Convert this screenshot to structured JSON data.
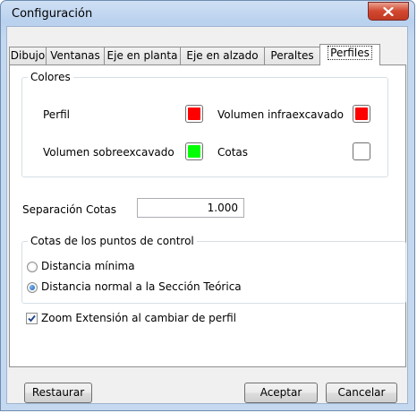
{
  "window": {
    "title": "Configuración",
    "close_glyph": "✕"
  },
  "tabs": [
    {
      "label": "Dibujo"
    },
    {
      "label": "Ventanas"
    },
    {
      "label": "Eje en planta"
    },
    {
      "label": "Eje en alzado"
    },
    {
      "label": "Peraltes"
    },
    {
      "label": "Perfiles",
      "active": true
    }
  ],
  "colores": {
    "legend": "Colores",
    "perfil": {
      "label": "Perfil",
      "color": "#ff0000"
    },
    "volumen_infra": {
      "label": "Volumen infraexcavado",
      "color": "#ff0000"
    },
    "volumen_sobre": {
      "label": "Volumen sobreexcavado",
      "color": "#00ff00"
    },
    "cotas": {
      "label": "Cotas",
      "color": "#ffffff"
    }
  },
  "separacion": {
    "label": "Separación Cotas",
    "value": "1.000"
  },
  "puntos_control": {
    "legend": "Cotas de los puntos de control",
    "options": [
      {
        "label": "Distancia mínima",
        "selected": false
      },
      {
        "label": "Distancia normal a la Sección Teórica",
        "selected": true
      }
    ]
  },
  "zoom": {
    "label": "Zoom Extensión al cambiar de perfil",
    "checked": true
  },
  "buttons": {
    "restaurar": "Restaurar",
    "aceptar": "Aceptar",
    "cancelar": "Cancelar"
  }
}
